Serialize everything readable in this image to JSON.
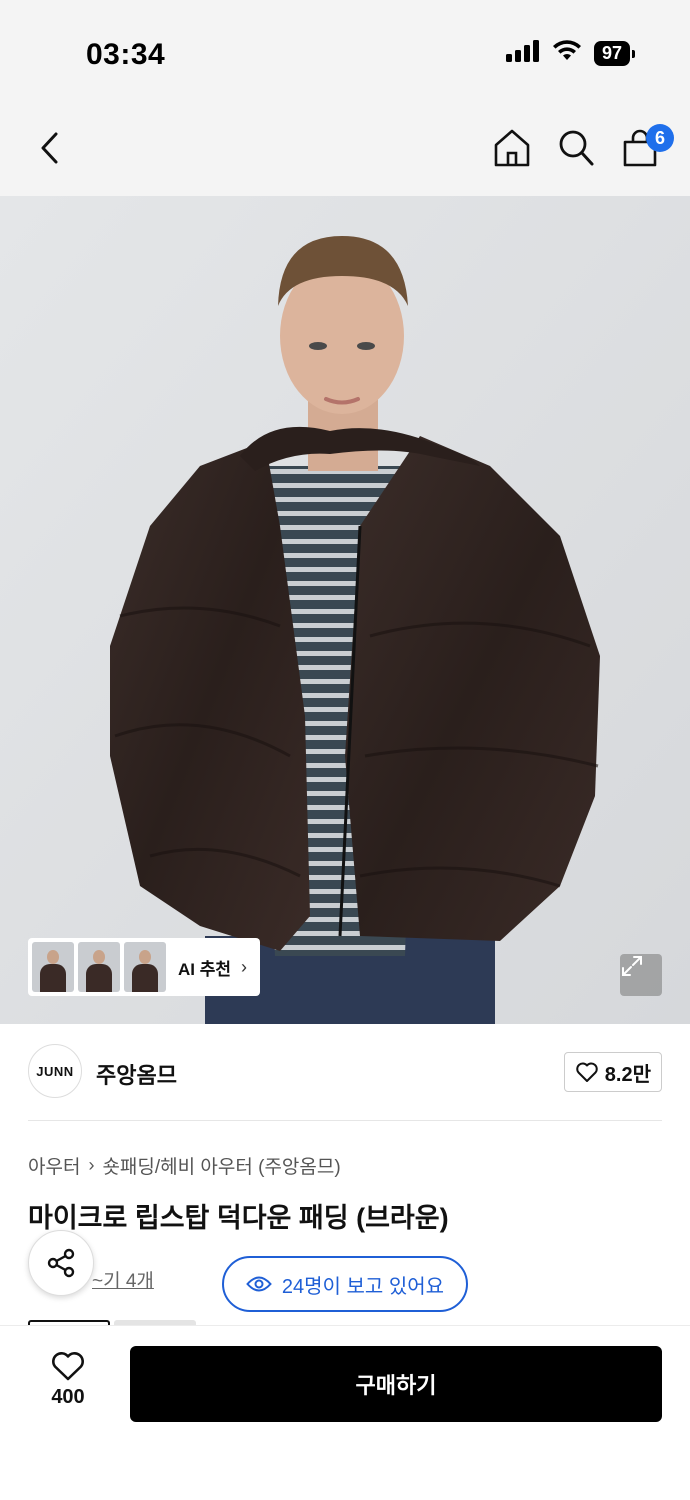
{
  "status_bar": {
    "time": "03:34",
    "battery": "97",
    "icons": [
      "signal-icon",
      "wifi-icon",
      "battery-icon"
    ]
  },
  "nav": {
    "icons": [
      "back-icon",
      "home-icon",
      "search-icon",
      "cart-icon"
    ],
    "cart_count": "6"
  },
  "hero": {
    "ai_recommend_label": "AI 추천",
    "expand_icon": "expand-icon"
  },
  "brand": {
    "logo_text": "JUNN",
    "name": "주앙옴므",
    "like_count": "8.2만"
  },
  "product": {
    "breadcrumb": [
      "아우터",
      "숏패딩/헤비 아우터 (주앙옴므)"
    ],
    "title": "마이크로 립스탑 덕다운 패딩 (브라운)",
    "review_link": "~기 4개",
    "viewers": "24명이 보고 있어요"
  },
  "bottom_bar": {
    "like_count": "400",
    "buy_label": "구매하기"
  },
  "colors": {
    "accent_blue": "#1f5fd6",
    "badge_blue": "#1f6feb",
    "buy_button": "#000000"
  }
}
